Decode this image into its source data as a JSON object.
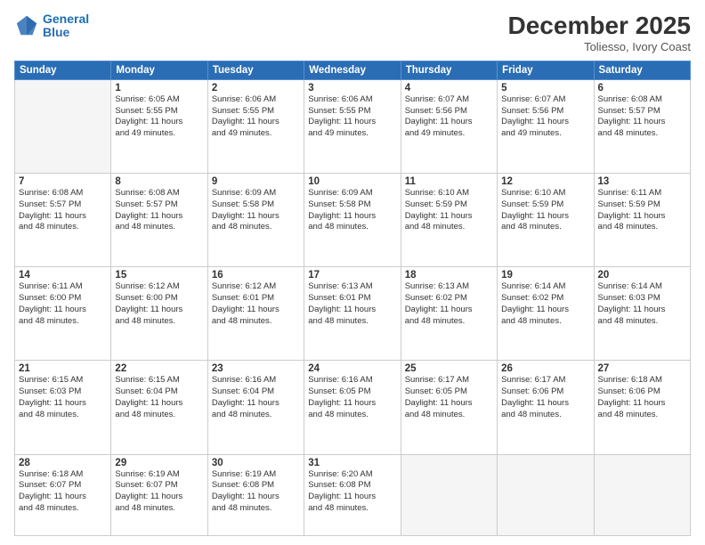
{
  "header": {
    "logo_line1": "General",
    "logo_line2": "Blue",
    "month_title": "December 2025",
    "subtitle": "Toliesso, Ivory Coast"
  },
  "weekdays": [
    "Sunday",
    "Monday",
    "Tuesday",
    "Wednesday",
    "Thursday",
    "Friday",
    "Saturday"
  ],
  "weeks": [
    [
      {
        "day": "",
        "info": ""
      },
      {
        "day": "1",
        "info": "Sunrise: 6:05 AM\nSunset: 5:55 PM\nDaylight: 11 hours\nand 49 minutes."
      },
      {
        "day": "2",
        "info": "Sunrise: 6:06 AM\nSunset: 5:55 PM\nDaylight: 11 hours\nand 49 minutes."
      },
      {
        "day": "3",
        "info": "Sunrise: 6:06 AM\nSunset: 5:55 PM\nDaylight: 11 hours\nand 49 minutes."
      },
      {
        "day": "4",
        "info": "Sunrise: 6:07 AM\nSunset: 5:56 PM\nDaylight: 11 hours\nand 49 minutes."
      },
      {
        "day": "5",
        "info": "Sunrise: 6:07 AM\nSunset: 5:56 PM\nDaylight: 11 hours\nand 49 minutes."
      },
      {
        "day": "6",
        "info": "Sunrise: 6:08 AM\nSunset: 5:57 PM\nDaylight: 11 hours\nand 48 minutes."
      }
    ],
    [
      {
        "day": "7",
        "info": "Sunrise: 6:08 AM\nSunset: 5:57 PM\nDaylight: 11 hours\nand 48 minutes."
      },
      {
        "day": "8",
        "info": "Sunrise: 6:08 AM\nSunset: 5:57 PM\nDaylight: 11 hours\nand 48 minutes."
      },
      {
        "day": "9",
        "info": "Sunrise: 6:09 AM\nSunset: 5:58 PM\nDaylight: 11 hours\nand 48 minutes."
      },
      {
        "day": "10",
        "info": "Sunrise: 6:09 AM\nSunset: 5:58 PM\nDaylight: 11 hours\nand 48 minutes."
      },
      {
        "day": "11",
        "info": "Sunrise: 6:10 AM\nSunset: 5:59 PM\nDaylight: 11 hours\nand 48 minutes."
      },
      {
        "day": "12",
        "info": "Sunrise: 6:10 AM\nSunset: 5:59 PM\nDaylight: 11 hours\nand 48 minutes."
      },
      {
        "day": "13",
        "info": "Sunrise: 6:11 AM\nSunset: 5:59 PM\nDaylight: 11 hours\nand 48 minutes."
      }
    ],
    [
      {
        "day": "14",
        "info": "Sunrise: 6:11 AM\nSunset: 6:00 PM\nDaylight: 11 hours\nand 48 minutes."
      },
      {
        "day": "15",
        "info": "Sunrise: 6:12 AM\nSunset: 6:00 PM\nDaylight: 11 hours\nand 48 minutes."
      },
      {
        "day": "16",
        "info": "Sunrise: 6:12 AM\nSunset: 6:01 PM\nDaylight: 11 hours\nand 48 minutes."
      },
      {
        "day": "17",
        "info": "Sunrise: 6:13 AM\nSunset: 6:01 PM\nDaylight: 11 hours\nand 48 minutes."
      },
      {
        "day": "18",
        "info": "Sunrise: 6:13 AM\nSunset: 6:02 PM\nDaylight: 11 hours\nand 48 minutes."
      },
      {
        "day": "19",
        "info": "Sunrise: 6:14 AM\nSunset: 6:02 PM\nDaylight: 11 hours\nand 48 minutes."
      },
      {
        "day": "20",
        "info": "Sunrise: 6:14 AM\nSunset: 6:03 PM\nDaylight: 11 hours\nand 48 minutes."
      }
    ],
    [
      {
        "day": "21",
        "info": "Sunrise: 6:15 AM\nSunset: 6:03 PM\nDaylight: 11 hours\nand 48 minutes."
      },
      {
        "day": "22",
        "info": "Sunrise: 6:15 AM\nSunset: 6:04 PM\nDaylight: 11 hours\nand 48 minutes."
      },
      {
        "day": "23",
        "info": "Sunrise: 6:16 AM\nSunset: 6:04 PM\nDaylight: 11 hours\nand 48 minutes."
      },
      {
        "day": "24",
        "info": "Sunrise: 6:16 AM\nSunset: 6:05 PM\nDaylight: 11 hours\nand 48 minutes."
      },
      {
        "day": "25",
        "info": "Sunrise: 6:17 AM\nSunset: 6:05 PM\nDaylight: 11 hours\nand 48 minutes."
      },
      {
        "day": "26",
        "info": "Sunrise: 6:17 AM\nSunset: 6:06 PM\nDaylight: 11 hours\nand 48 minutes."
      },
      {
        "day": "27",
        "info": "Sunrise: 6:18 AM\nSunset: 6:06 PM\nDaylight: 11 hours\nand 48 minutes."
      }
    ],
    [
      {
        "day": "28",
        "info": "Sunrise: 6:18 AM\nSunset: 6:07 PM\nDaylight: 11 hours\nand 48 minutes."
      },
      {
        "day": "29",
        "info": "Sunrise: 6:19 AM\nSunset: 6:07 PM\nDaylight: 11 hours\nand 48 minutes."
      },
      {
        "day": "30",
        "info": "Sunrise: 6:19 AM\nSunset: 6:08 PM\nDaylight: 11 hours\nand 48 minutes."
      },
      {
        "day": "31",
        "info": "Sunrise: 6:20 AM\nSunset: 6:08 PM\nDaylight: 11 hours\nand 48 minutes."
      },
      {
        "day": "",
        "info": ""
      },
      {
        "day": "",
        "info": ""
      },
      {
        "day": "",
        "info": ""
      }
    ]
  ]
}
